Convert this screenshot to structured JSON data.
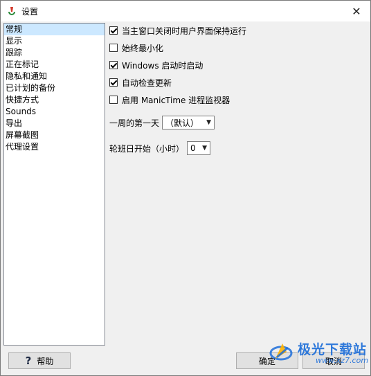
{
  "window": {
    "title": "设置",
    "close_label": "✕"
  },
  "nav": {
    "items": [
      {
        "label": "常规",
        "selected": true
      },
      {
        "label": "显示"
      },
      {
        "label": "跟踪"
      },
      {
        "label": "正在标记"
      },
      {
        "label": "隐私和通知"
      },
      {
        "label": "已计划的备份"
      },
      {
        "label": "快捷方式"
      },
      {
        "label": "Sounds"
      },
      {
        "label": "导出"
      },
      {
        "label": "屏幕截图"
      },
      {
        "label": "代理设置"
      }
    ]
  },
  "general": {
    "options": [
      {
        "label": "当主窗口关闭时用户界面保持运行",
        "checked": true
      },
      {
        "label": "始终最小化",
        "checked": false
      },
      {
        "label": "Windows 启动时启动",
        "checked": true
      },
      {
        "label": "自动检查更新",
        "checked": true
      },
      {
        "label": "启用 ManicTime 进程监视器",
        "checked": false
      }
    ],
    "first_day": {
      "label": "一周的第一天",
      "value": "（默认）"
    },
    "shift_start": {
      "label": "轮班日开始（小时）",
      "value": "0"
    }
  },
  "buttons": {
    "help": "帮助",
    "help_icon": "?",
    "ok": "确定",
    "cancel": "取消"
  },
  "watermark": {
    "text": "极光下载站",
    "url": "www.xz7.com"
  },
  "colors": {
    "selected_bg": "#cce8ff",
    "watermark_blue": "#1f6fd9"
  }
}
